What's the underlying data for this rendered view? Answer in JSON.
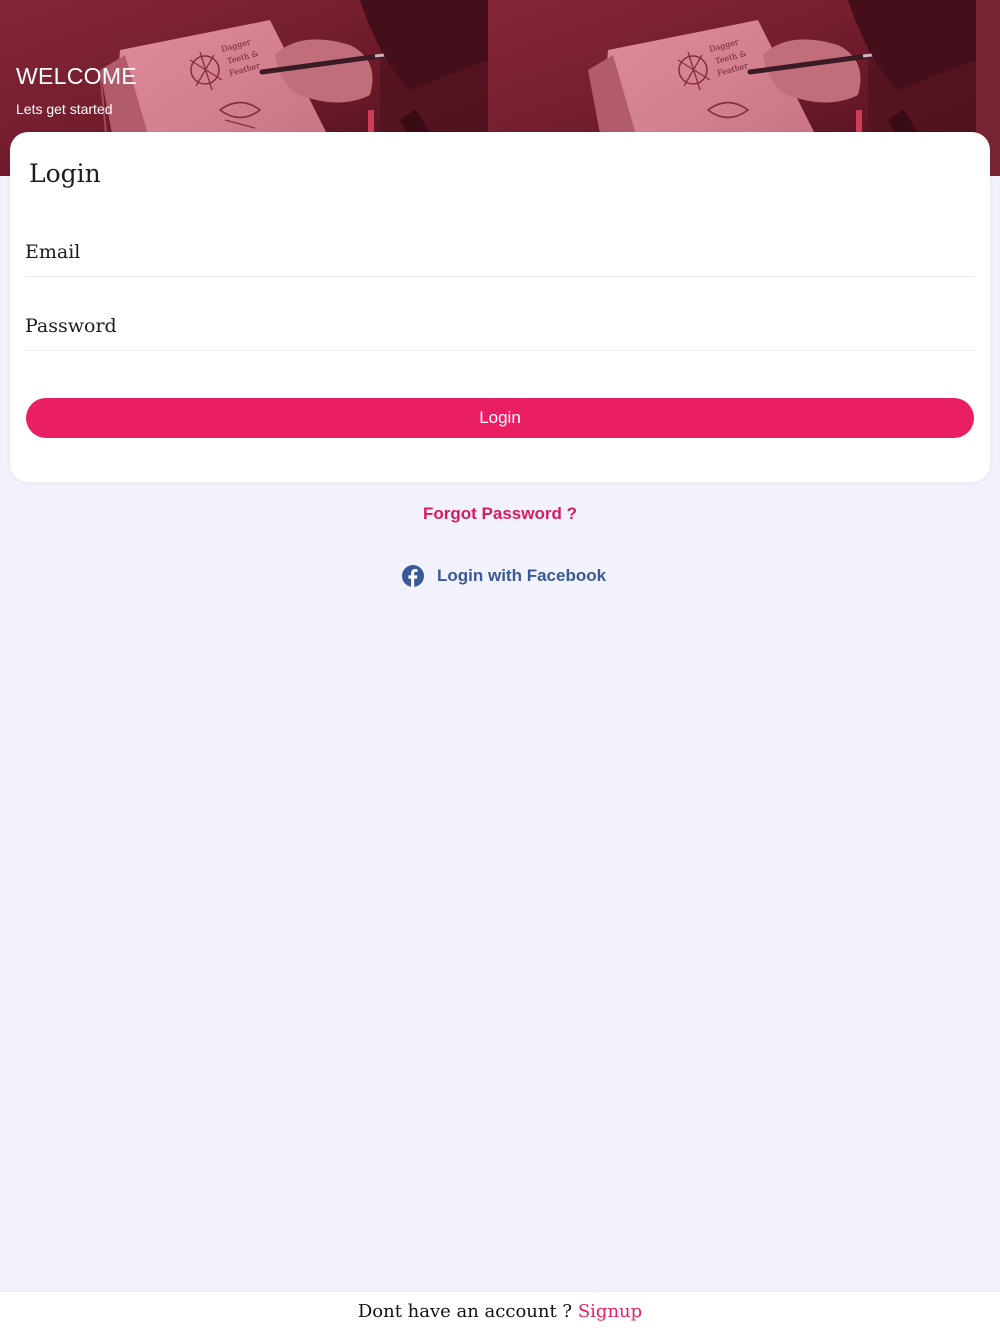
{
  "header": {
    "title": "WELCOME",
    "subtitle": "Lets get started"
  },
  "login_card": {
    "title": "Login",
    "email_placeholder": "Email",
    "password_placeholder": "Password",
    "submit_label": "Login"
  },
  "links": {
    "forgot_password": "Forgot Password ?",
    "facebook_login": "Login with Facebook"
  },
  "footer": {
    "prompt": "Dont have an account ?",
    "signup_label": "Signup"
  },
  "icons": {
    "facebook": "facebook-icon"
  },
  "colors": {
    "accent": "#e91e63",
    "facebook": "#3b5998",
    "background": "#f2f2fc"
  }
}
